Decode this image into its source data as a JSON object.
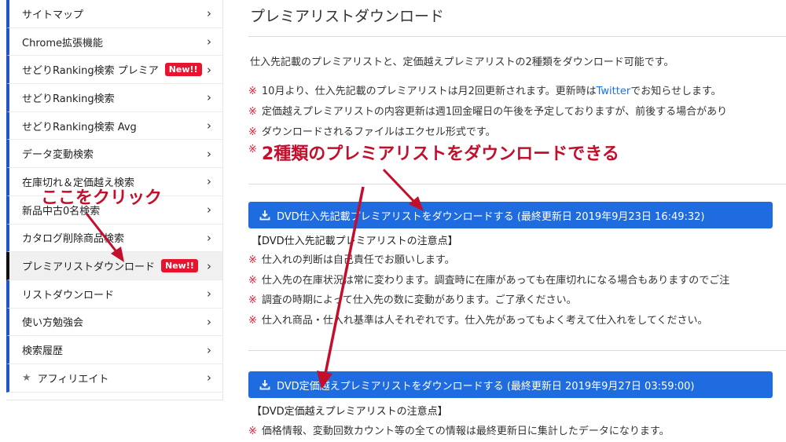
{
  "sidebar": {
    "items": [
      {
        "label": "サイトマップ"
      },
      {
        "label": "Chrome拡張機能"
      },
      {
        "label": "せどりRanking検索 プレミア",
        "badge": "New!!"
      },
      {
        "label": "せどりRanking検索"
      },
      {
        "label": "せどりRanking検索 Avg"
      },
      {
        "label": "データ変動検索"
      },
      {
        "label": "在庫切れ＆定価越え検索"
      },
      {
        "label": "新品中古0名検索"
      },
      {
        "label": "カタログ削除商品検索"
      },
      {
        "label": "プレミアリストダウンロード",
        "badge": "New!!",
        "active": true
      },
      {
        "label": "リストダウンロード"
      },
      {
        "label": "使い方勉強会"
      },
      {
        "label": "検索履歴"
      },
      {
        "label": "アフィリエイト",
        "icon": "star-icon"
      }
    ]
  },
  "main": {
    "title": "プレミアリストダウンロード",
    "intro": "仕入先記載のプレミアリストと、定価越えプレミアリストの2種類をダウンロード可能です。",
    "notes": [
      {
        "mark": "※",
        "text": "10月より、仕入先記載のプレミアリストは月2回更新されます。更新時は",
        "link": "Twitter",
        "text2": "でお知らせします。"
      },
      {
        "mark": "※",
        "text": "定価越えプレミアリストの内容更新は週1回金曜日の午後を予定しておりますが、前後する場合があり"
      },
      {
        "mark": "※",
        "text": "ダウンロードされるファイルはエクセル形式です。"
      },
      {
        "mark": "※",
        "text": ""
      }
    ],
    "button1": "DVD仕入先記載プレミアリストをダウンロードする (最終更新日 2019年9月23日 16:49:32)",
    "caution1_title": "【DVD仕入先記載プレミアリストの注意点】",
    "caution1": [
      {
        "mark": "※",
        "text": "仕入れの判断は自己責任でお願いします。"
      },
      {
        "mark": "※",
        "text": "仕入先の在庫状況は常に変わります。調査時に在庫があっても在庫切れになる場合もありますのでご注"
      },
      {
        "mark": "※",
        "text": "調査の時期によって仕入先の数に変動があります。ご了承ください。"
      },
      {
        "mark": "※",
        "text": "仕入れ商品・仕入れ基準は人それぞれです。仕入先があってもよく考えて仕入れをしてください。"
      }
    ],
    "button2": "DVD定価越えプレミアリストをダウンロードする (最終更新日 2019年9月27日 03:59:00)",
    "caution2_title": "【DVD定価越えプレミアリストの注意点】",
    "caution2": [
      {
        "mark": "※",
        "text": "価格情報、変動回数カウント等の全ての情報は最終更新日に集計したデータになります。"
      }
    ]
  },
  "annotations": {
    "click_here": "ここをクリック",
    "headline": "2種類のプレミアリストをダウンロードできる"
  },
  "colors": {
    "accent": "#1f6ce0",
    "note_mark": "#e31b2f",
    "annotation": "#c30f2c",
    "badge": "#e8142e"
  }
}
